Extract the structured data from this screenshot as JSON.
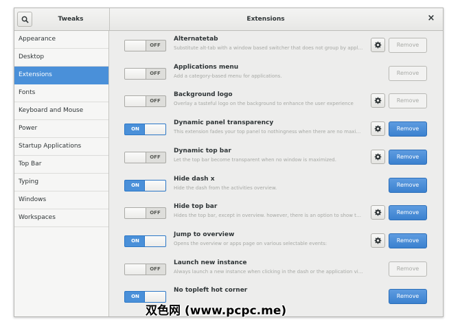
{
  "header": {
    "left_title": "Tweaks",
    "main_title": "Extensions",
    "search_icon": "search-icon",
    "close_glyph": "×"
  },
  "sidebar": {
    "selected": 2,
    "items": [
      {
        "label": "Appearance"
      },
      {
        "label": "Desktop"
      },
      {
        "label": "Extensions"
      },
      {
        "label": "Fonts"
      },
      {
        "label": "Keyboard and Mouse"
      },
      {
        "label": "Power"
      },
      {
        "label": "Startup Applications"
      },
      {
        "label": "Top Bar"
      },
      {
        "label": "Typing"
      },
      {
        "label": "Windows"
      },
      {
        "label": "Workspaces"
      }
    ]
  },
  "extensions": [
    {
      "name": "Alternatetab",
      "desc": "Substitute alt-tab with a window based switcher that does not group by application.",
      "state": "OFF",
      "has_settings": true,
      "remove": "Remove",
      "remove_active": false
    },
    {
      "name": "Applications menu",
      "desc": "Add a category-based menu for applications.",
      "state": "OFF",
      "has_settings": false,
      "remove": "Remove",
      "remove_active": false
    },
    {
      "name": "Background logo",
      "desc": "Overlay a tasteful logo on the background to enhance the user experience",
      "state": "OFF",
      "has_settings": true,
      "remove": "Remove",
      "remove_active": false
    },
    {
      "name": "Dynamic panel transparency",
      "desc": "This extension fades your top panel to nothingness when there are no maximized windows.",
      "state": "ON",
      "has_settings": true,
      "remove": "Remove",
      "remove_active": true
    },
    {
      "name": "Dynamic top bar",
      "desc": "Let the top bar become transparent when no window is maximized.",
      "state": "OFF",
      "has_settings": true,
      "remove": "Remove",
      "remove_active": true
    },
    {
      "name": "Hide dash x",
      "desc": "Hide the dash from the activities overview.",
      "state": "ON",
      "has_settings": false,
      "remove": "Remove",
      "remove_active": true
    },
    {
      "name": "Hide top bar",
      "desc": "Hides the top bar, except in overview. however, there is an option to show the panel.",
      "state": "OFF",
      "has_settings": true,
      "remove": "Remove",
      "remove_active": true
    },
    {
      "name": "Jump to overview",
      "desc": "Opens the overview or apps page on various selectable events:",
      "state": "ON",
      "has_settings": true,
      "remove": "Remove",
      "remove_active": true
    },
    {
      "name": "Launch new instance",
      "desc": "Always launch a new instance when clicking in the dash or the application view.",
      "state": "OFF",
      "has_settings": false,
      "remove": "Remove",
      "remove_active": false
    },
    {
      "name": "No topleft hot corner",
      "desc": "",
      "state": "ON",
      "has_settings": false,
      "remove": "Remove",
      "remove_active": true
    }
  ],
  "colors": {
    "accent": "#4a90d9",
    "selected_text": "#ffffff",
    "muted_text": "#a6a8a4"
  },
  "watermark": "双色网 (www.pcpc.me)"
}
